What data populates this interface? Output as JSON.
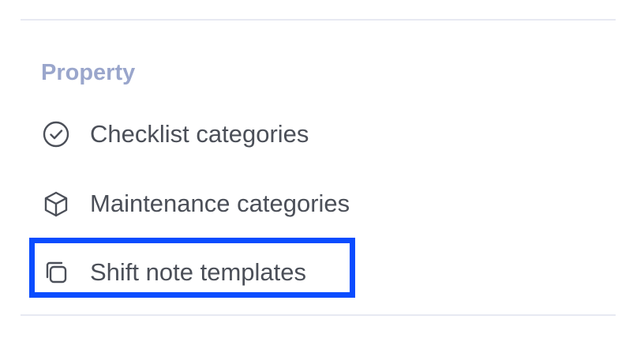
{
  "section": {
    "title": "Property"
  },
  "menu": {
    "items": [
      {
        "label": "Checklist categories",
        "icon": "check-circle-icon"
      },
      {
        "label": "Maintenance categories",
        "icon": "cube-icon"
      },
      {
        "label": "Shift note templates",
        "icon": "copy-icon"
      }
    ]
  },
  "colors": {
    "section_title": "#9aa6cc",
    "text": "#4b4f58",
    "divider": "#e7e9f2",
    "highlight": "#0a4cff"
  }
}
